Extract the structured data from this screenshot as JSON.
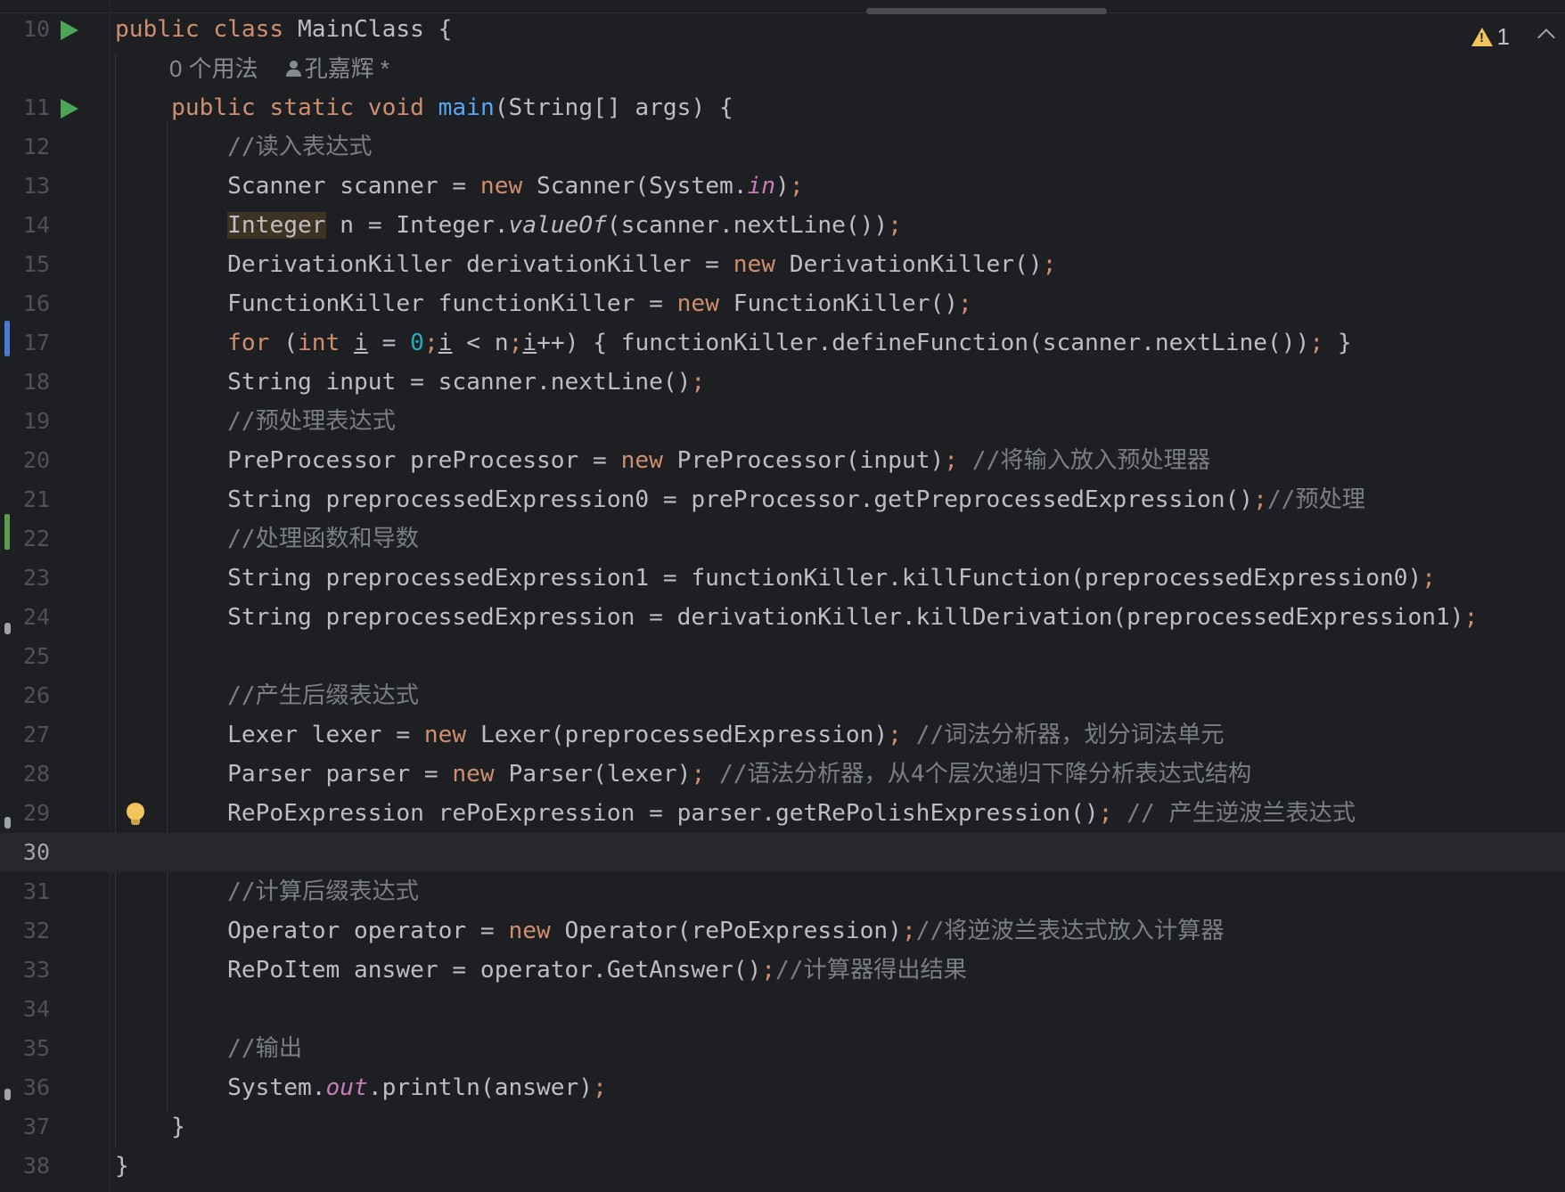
{
  "editor": {
    "inspection": {
      "warning_count": "1"
    },
    "code_vision": {
      "usages": "0 个用法",
      "author": "孔嘉辉 *"
    },
    "lines": [
      {
        "num": "10",
        "text": "public class MainClass {"
      },
      {
        "num": "11",
        "text": "    public static void main(String[] args) {"
      },
      {
        "num": "12",
        "text": "        //读入表达式"
      },
      {
        "num": "13",
        "text": "        Scanner scanner = new Scanner(System.in);"
      },
      {
        "num": "14",
        "text": "        Integer n = Integer.valueOf(scanner.nextLine());"
      },
      {
        "num": "15",
        "text": "        DerivationKiller derivationKiller = new DerivationKiller();"
      },
      {
        "num": "16",
        "text": "        FunctionKiller functionKiller = new FunctionKiller();"
      },
      {
        "num": "17",
        "text": "        for (int i = 0;i < n;i++) { functionKiller.defineFunction(scanner.nextLine()); }"
      },
      {
        "num": "18",
        "text": "        String input = scanner.nextLine();"
      },
      {
        "num": "19",
        "text": "        //预处理表达式"
      },
      {
        "num": "20",
        "text": "        PreProcessor preProcessor = new PreProcessor(input); //将输入放入预处理器"
      },
      {
        "num": "21",
        "text": "        String preprocessedExpression0 = preProcessor.getPreprocessedExpression();//预处理"
      },
      {
        "num": "22",
        "text": "        //处理函数和导数"
      },
      {
        "num": "23",
        "text": "        String preprocessedExpression1 = functionKiller.killFunction(preprocessedExpression0);"
      },
      {
        "num": "24",
        "text": "        String preprocessedExpression = derivationKiller.killDerivation(preprocessedExpression1);"
      },
      {
        "num": "25",
        "text": ""
      },
      {
        "num": "26",
        "text": "        //产生后缀表达式"
      },
      {
        "num": "27",
        "text": "        Lexer lexer = new Lexer(preprocessedExpression); //词法分析器，划分词法单元"
      },
      {
        "num": "28",
        "text": "        Parser parser = new Parser(lexer); //语法分析器，从4个层次递归下降分析表达式结构"
      },
      {
        "num": "29",
        "text": "        RePoExpression rePoExpression = parser.getRePolishExpression(); // 产生逆波兰表达式"
      },
      {
        "num": "30",
        "text": ""
      },
      {
        "num": "31",
        "text": "        //计算后缀表达式"
      },
      {
        "num": "32",
        "text": "        Operator operator = new Operator(rePoExpression);//将逆波兰表达式放入计算器"
      },
      {
        "num": "33",
        "text": "        RePoItem answer = operator.GetAnswer();//计算器得出结果"
      },
      {
        "num": "34",
        "text": ""
      },
      {
        "num": "35",
        "text": "        //输出"
      },
      {
        "num": "36",
        "text": "        System.out.println(answer);"
      },
      {
        "num": "37",
        "text": "    }"
      },
      {
        "num": "38",
        "text": "}"
      }
    ],
    "current_line": "30",
    "colors": {
      "background": "#1e1f22",
      "keyword": "#cf8e6d",
      "comment": "#7a7e85",
      "number": "#2aacb8",
      "static_field": "#c77dbb",
      "method_decl": "#56a8f5",
      "run_gutter": "#4da557",
      "warning": "#f2c55c"
    }
  }
}
